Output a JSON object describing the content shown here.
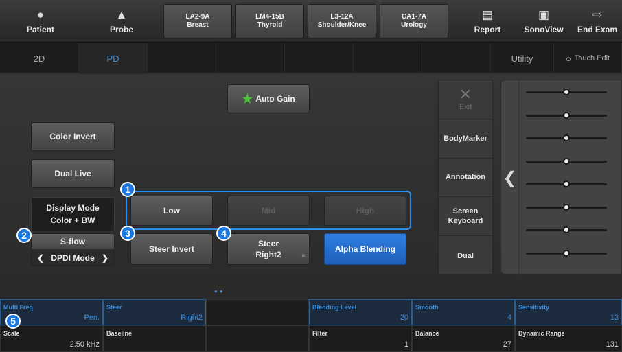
{
  "topbar": {
    "patient": {
      "icon": "person-icon",
      "label": "Patient"
    },
    "probe": {
      "icon": "probe-icon",
      "label": "Probe"
    },
    "probes": [
      {
        "name": "LA2-9A",
        "app": "Breast"
      },
      {
        "name": "LM4-15B",
        "app": "Thyroid"
      },
      {
        "name": "L3-12A",
        "app": "Shoulder/Knee"
      },
      {
        "name": "CA1-7A",
        "app": "Urology"
      }
    ],
    "report": {
      "icon": "report-icon",
      "label": "Report"
    },
    "sonoview": {
      "icon": "sonoview-icon",
      "label": "SonoView"
    },
    "end_exam": {
      "icon": "exit-door-icon",
      "label": "End Exam"
    }
  },
  "tabs": {
    "t2d": "2D",
    "pd": "PD",
    "utility": "Utility",
    "touch_edit": "Touch Edit",
    "active": "PD"
  },
  "controls": {
    "auto_gain": "Auto Gain",
    "color_invert": "Color Invert",
    "dual_live": "Dual Live",
    "display_mode_label": "Display Mode",
    "display_mode_value": "Color + BW",
    "sflow_label": "S-flow",
    "sflow_value": "DPDI Mode",
    "low": "Low",
    "mid": "Mid",
    "high": "High",
    "steer_invert": "Steer Invert",
    "steer_label": "Steer",
    "steer_value": "Right2",
    "alpha_blending": "Alpha Blending"
  },
  "badges": [
    "1",
    "2",
    "3",
    "4",
    "5"
  ],
  "right_panel": {
    "exit": "Exit",
    "bodymarker": "BodyMarker",
    "annotation": "Annotation",
    "screen_keyboard_1": "Screen",
    "screen_keyboard_2": "Keyboard",
    "dual": "Dual"
  },
  "tgc": {
    "count": 8,
    "levels": [
      0.5,
      0.5,
      0.5,
      0.5,
      0.5,
      0.5,
      0.5,
      0.5
    ]
  },
  "bottom": {
    "row1": [
      {
        "name": "Multi Freq",
        "value": "Pen."
      },
      {
        "name": "Steer",
        "value": "Right2"
      },
      {
        "name": "",
        "value": ""
      },
      {
        "name": "Blending Level",
        "value": "20"
      },
      {
        "name": "Smooth",
        "value": "4"
      },
      {
        "name": "Sensitivity",
        "value": "13"
      }
    ],
    "row2": [
      {
        "name": "Scale",
        "value": "2.50 kHz"
      },
      {
        "name": "Baseline",
        "value": ""
      },
      {
        "name": "",
        "value": ""
      },
      {
        "name": "Filter",
        "value": "1"
      },
      {
        "name": "Balance",
        "value": "27"
      },
      {
        "name": "Dynamic Range",
        "value": "131"
      }
    ]
  },
  "colors": {
    "accent": "#2d8fe6",
    "star": "#4dc23c"
  }
}
